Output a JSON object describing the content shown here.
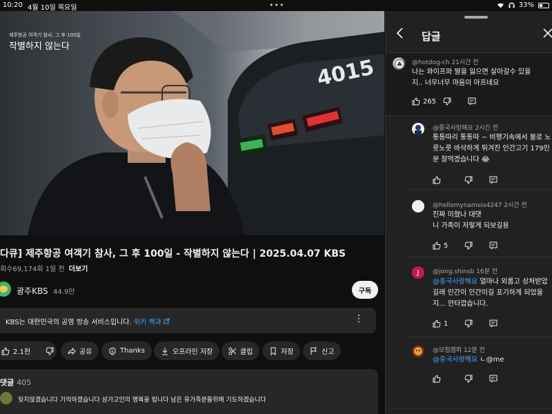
{
  "status": {
    "time": "10:20",
    "date": "4월 10일 목요일",
    "dots": "•••",
    "battery": "33%"
  },
  "video": {
    "overlay_sub": "제주항공 여객기 참사, 그 후 100일",
    "overlay_title": "작별하지 않는다",
    "bus_number": "4015",
    "title": "다큐] 제주항공 여객기 참사, 그 후 100일 - 작별하지 않는다 | 2025.04.07 KBS",
    "meta": "회수69,174회   1일 전",
    "more": "더보기"
  },
  "channel": {
    "name": "광주KBS",
    "subs": "44.9만",
    "subscribe": "구독"
  },
  "infobar": {
    "text": "KBS는 대한민국의 공영 방송 서비스입니다.",
    "link": "위키 백과"
  },
  "actions": {
    "like_count": "2.1천",
    "share": "공유",
    "thanks": "Thanks",
    "offline": "오프라인 저장",
    "clip": "클립",
    "save": "저장",
    "report": "신고"
  },
  "comments_section": {
    "header": "댓글",
    "count": "405",
    "top_comment": "잊지않겠습니다 기억하겠습니다 삼가고인의 명복을 빕니다 남은 유가족분들위해 기도하겠습니다"
  },
  "panel": {
    "title": "답글",
    "parent": {
      "author": "@hotdog-ch",
      "time": "21시간 전",
      "text": "나는 와이프와 딸을 잃으면 살아갈수 있을지.. 너무너무 마음이 아프네요",
      "likes": "265"
    },
    "replies": [
      {
        "author": "@중국사랑해요",
        "time": "2시간 전",
        "text": "통통따리 통통따 ~ 비행기속에서 불로 노릇노릇 바삭하게 튀겨진 인간고기 179인분 잘먹겠습니다 😂",
        "likes": "",
        "mention": ""
      },
      {
        "author": "@hellomynameis4247",
        "time": "2시간 전",
        "text": "진짜 미쳤나 대댓\n니 가족이 저렇게 되보길용",
        "likes": "5",
        "mention": ""
      },
      {
        "author": "@jong.shinsb",
        "time": "16분 전",
        "mention": "@중국사랑해요",
        "text": " 얼마나 외롭고 상처받았길래 인간이 인간이길 포기하게 되었을지... 안타깝습니다.",
        "likes": "1"
      },
      {
        "author": "@모험캠퍼",
        "time": "12분 전",
        "mention": "@중국사랑해요",
        "text": " ㄴ@me",
        "likes": ""
      }
    ],
    "reply_avatar_letter": "J"
  },
  "colors": {
    "accent_link": "#3ea6ff",
    "bg": "#0f0f0f",
    "panel_bg": "#212121",
    "chip_bg": "#272727"
  }
}
